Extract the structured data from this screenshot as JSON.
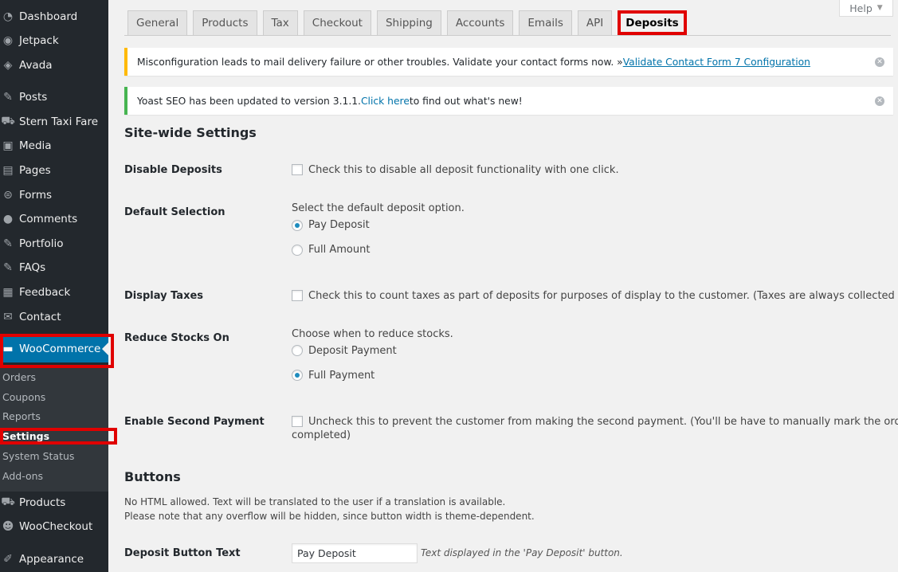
{
  "sidebar": {
    "items": [
      {
        "label": "Dashboard",
        "icon": "dashboard-icon"
      },
      {
        "label": "Jetpack",
        "icon": "jetpack-icon"
      },
      {
        "label": "Avada",
        "icon": "avada-icon"
      },
      {
        "label": "Posts",
        "icon": "pin-icon"
      },
      {
        "label": "Stern Taxi Fare",
        "icon": "cart-icon"
      },
      {
        "label": "Media",
        "icon": "media-icon"
      },
      {
        "label": "Pages",
        "icon": "pages-icon"
      },
      {
        "label": "Forms",
        "icon": "forms-icon"
      },
      {
        "label": "Comments",
        "icon": "comment-icon"
      },
      {
        "label": "Portfolio",
        "icon": "pin-icon"
      },
      {
        "label": "FAQs",
        "icon": "pin-icon"
      },
      {
        "label": "Feedback",
        "icon": "feedback-icon"
      },
      {
        "label": "Contact",
        "icon": "mail-icon"
      },
      {
        "label": "WooCommerce",
        "icon": "woo-icon"
      },
      {
        "label": "Products",
        "icon": "cart-icon"
      },
      {
        "label": "WooCheckout",
        "icon": "person-icon"
      },
      {
        "label": "Appearance",
        "icon": "brush-icon"
      }
    ],
    "submenu": [
      "Orders",
      "Coupons",
      "Reports",
      "Settings",
      "System Status",
      "Add-ons"
    ]
  },
  "help": {
    "label": "Help"
  },
  "tabs": [
    "General",
    "Products",
    "Tax",
    "Checkout",
    "Shipping",
    "Accounts",
    "Emails",
    "API",
    "Deposits"
  ],
  "notices": {
    "cf7": {
      "text": "Misconfiguration leads to mail delivery failure or other troubles. Validate your contact forms now. » ",
      "link": "Validate Contact Form 7 Configuration"
    },
    "yoast": {
      "text_before": "Yoast SEO has been updated to version 3.1.1. ",
      "link": "Click here",
      "text_after": " to find out what's new!"
    }
  },
  "site_wide": {
    "title": "Site-wide Settings",
    "disable_deposits": {
      "label": "Disable Deposits",
      "text": "Check this to disable all deposit functionality with one click."
    },
    "default_selection": {
      "label": "Default Selection",
      "text": "Select the default deposit option.",
      "options": [
        "Pay Deposit",
        "Full Amount"
      ],
      "selected": "Pay Deposit"
    },
    "display_taxes": {
      "label": "Display Taxes",
      "text": "Check this to count taxes as part of deposits for purposes of display to the customer. (Taxes are always collected upfront)"
    },
    "reduce_stocks": {
      "label": "Reduce Stocks On",
      "text": "Choose when to reduce stocks.",
      "options": [
        "Deposit Payment",
        "Full Payment"
      ],
      "selected": "Full Payment"
    },
    "second_payment": {
      "label": "Enable Second Payment",
      "text_line1": "Uncheck this to prevent the customer from making the second payment. (You'll be have to manually mark the order as",
      "text_line2": "completed)"
    }
  },
  "buttons": {
    "title": "Buttons",
    "desc_line1": "No HTML allowed. Text will be translated to the user if a translation is available.",
    "desc_line2": "Please note that any overflow will be hidden, since button width is theme-dependent.",
    "deposit_button": {
      "label": "Deposit Button Text",
      "value": "Pay Deposit",
      "desc": "Text displayed in the 'Pay Deposit' button."
    }
  }
}
